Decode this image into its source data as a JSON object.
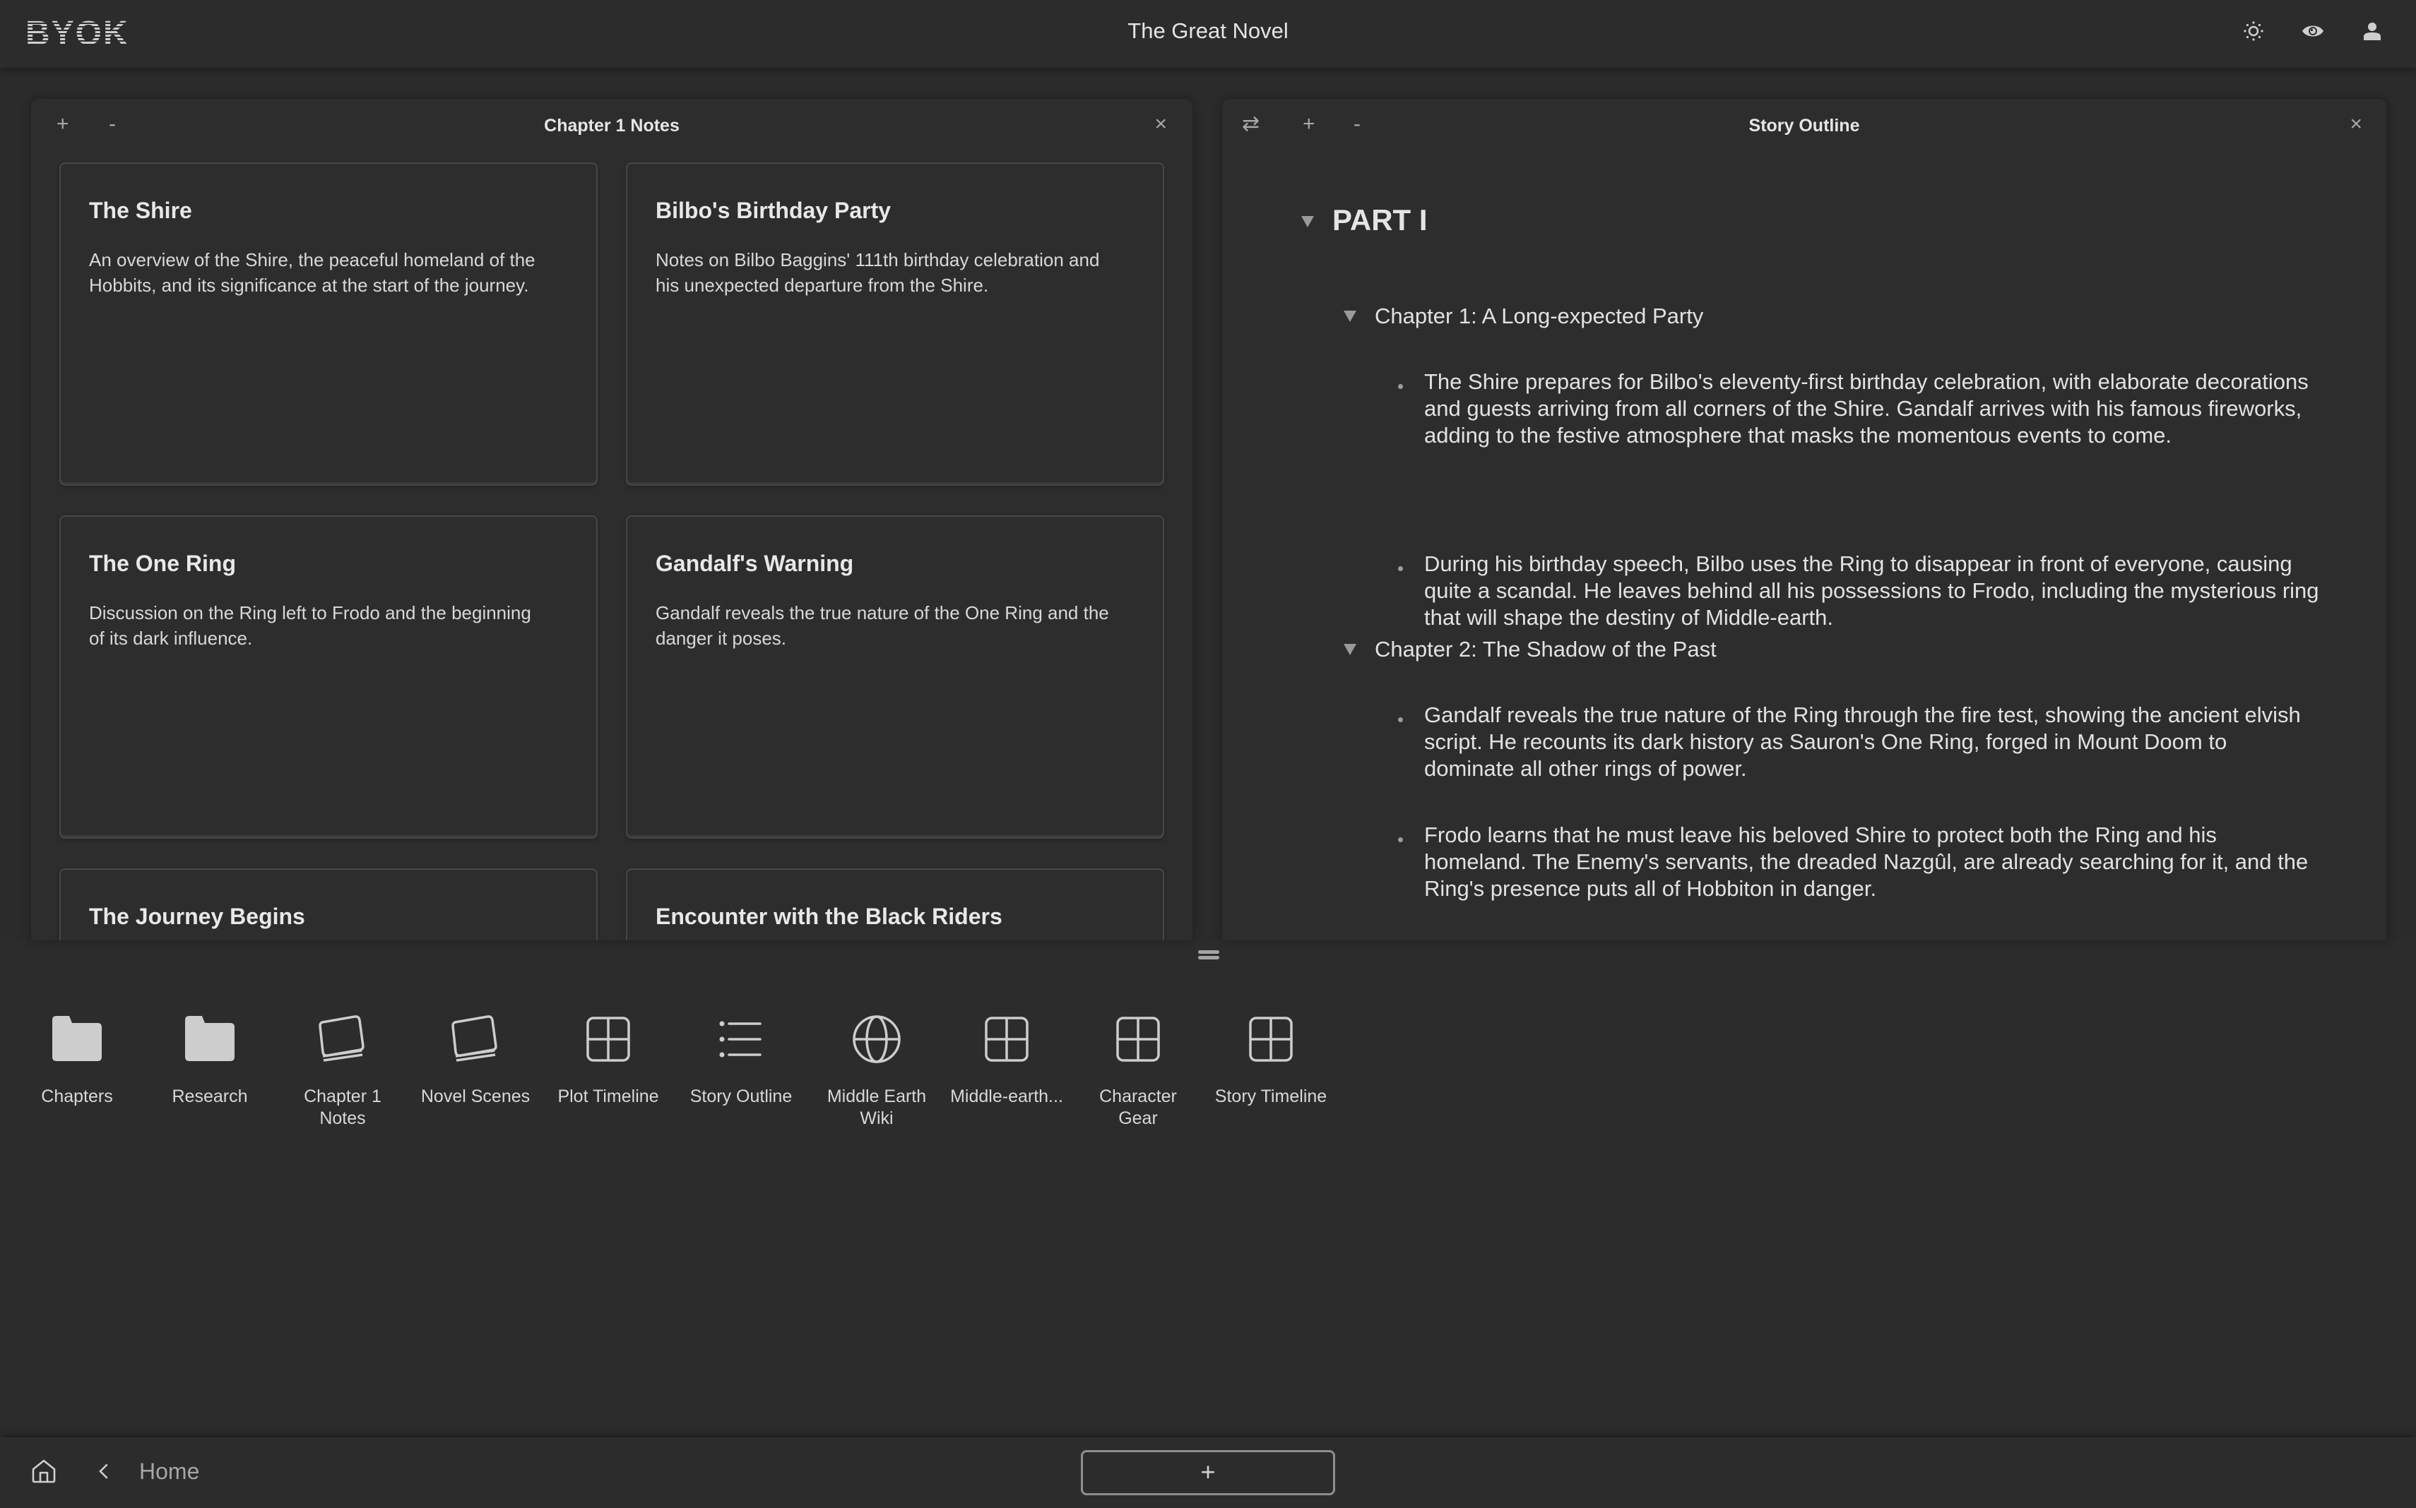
{
  "header": {
    "logo": "BYOK",
    "title": "The Great Novel",
    "icons": [
      "theme-toggle-icon",
      "preview-eye-icon",
      "user-account-icon"
    ]
  },
  "panels": {
    "left": {
      "title": "Chapter 1 Notes",
      "controls": {
        "zoom_in": "+",
        "zoom_out": "-",
        "close": "×"
      },
      "cards": [
        {
          "title": "The Shire",
          "body": "An overview of the Shire, the peaceful homeland of the Hobbits, and its significance at the start of the journey."
        },
        {
          "title": "Bilbo's Birthday Party",
          "body": "Notes on Bilbo Baggins' 111th birthday celebration and his unexpected departure from the Shire."
        },
        {
          "title": "The One Ring",
          "body": "Discussion on the Ring left to Frodo and the beginning of its dark influence."
        },
        {
          "title": "Gandalf's Warning",
          "body": "Gandalf reveals the true nature of the One Ring and the danger it poses."
        },
        {
          "title": "The Journey Begins",
          "body": ""
        },
        {
          "title": "Encounter with the Black Riders",
          "body": ""
        }
      ]
    },
    "right": {
      "title": "Story Outline",
      "controls": {
        "swap": "⇄",
        "zoom_in": "+",
        "zoom_out": "-",
        "close": "×"
      },
      "outline": {
        "part": "PART I",
        "chapters": [
          {
            "title": "Chapter 1: A Long-expected Party",
            "bullets": [
              "The Shire prepares for Bilbo's eleventy-first birthday celebration, with elaborate decorations and guests arriving from all corners of the Shire. Gandalf arrives with his famous fireworks, adding to the festive atmosphere that masks the momentous events to come.",
              "During his birthday speech, Bilbo uses the Ring to disappear in front of everyone, causing quite a scandal. He leaves behind all his possessions to Frodo, including the mysterious ring that will shape the destiny of Middle-earth."
            ]
          },
          {
            "title": "Chapter 2: The Shadow of the Past",
            "bullets": [
              "Gandalf reveals the true nature of the Ring through the fire test, showing the ancient elvish script. He recounts its dark history as Sauron's One Ring, forged in Mount Doom to dominate all other rings of power.",
              "Frodo learns that he must leave his beloved Shire to protect both the Ring and his homeland. The Enemy's servants, the dreaded Nazgûl, are already searching for it, and the Ring's presence puts all of Hobbiton in danger."
            ]
          }
        ]
      }
    }
  },
  "dock": {
    "items": [
      {
        "label": "Chapters",
        "icon": "folder-icon"
      },
      {
        "label": "Research",
        "icon": "folder-icon"
      },
      {
        "label": "Chapter 1 Notes",
        "icon": "card-stack-icon"
      },
      {
        "label": "Novel Scenes",
        "icon": "card-stack-icon"
      },
      {
        "label": "Plot Timeline",
        "icon": "grid-icon"
      },
      {
        "label": "Story Outline",
        "icon": "list-icon"
      },
      {
        "label": "Middle Earth Wiki",
        "icon": "globe-icon"
      },
      {
        "label": "Middle-earth...",
        "icon": "grid-icon"
      },
      {
        "label": "Character Gear",
        "icon": "grid-icon"
      },
      {
        "label": "Story Timeline",
        "icon": "grid-icon"
      }
    ]
  },
  "bottombar": {
    "breadcrumb": "Home",
    "add_label": "+"
  },
  "colors": {
    "background": "#2c2c2c",
    "panel": "#2d2d2d",
    "card_border": "#474747",
    "text": "#e6e6e6",
    "muted": "#a6a6a6"
  }
}
